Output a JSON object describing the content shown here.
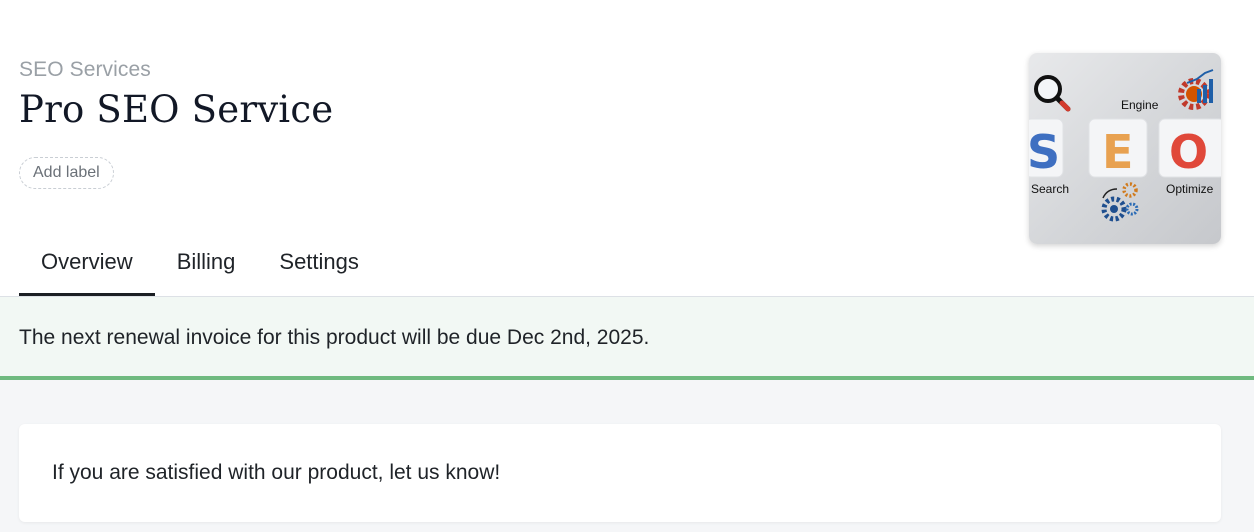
{
  "product": {
    "category": "SEO Services",
    "title": "Pro SEO Service",
    "add_label": "Add label",
    "image": {
      "icon": "seo-logo-image",
      "letters": [
        "S",
        "E",
        "O"
      ],
      "captions": {
        "search": "Search",
        "engine": "Engine",
        "optimize": "Optimize"
      },
      "colors": {
        "s": "#3e6fc1",
        "e": "#e8a150",
        "o": "#e0483a"
      }
    }
  },
  "tabs": [
    {
      "label": "Overview",
      "active": true
    },
    {
      "label": "Billing",
      "active": false
    },
    {
      "label": "Settings",
      "active": false
    }
  ],
  "notice": {
    "text": "The next renewal invoice for this product will be due Dec 2nd, 2025.",
    "accent_color": "#6fba7f"
  },
  "feedback": {
    "text": "If you are satisfied with our product, let us know!"
  }
}
